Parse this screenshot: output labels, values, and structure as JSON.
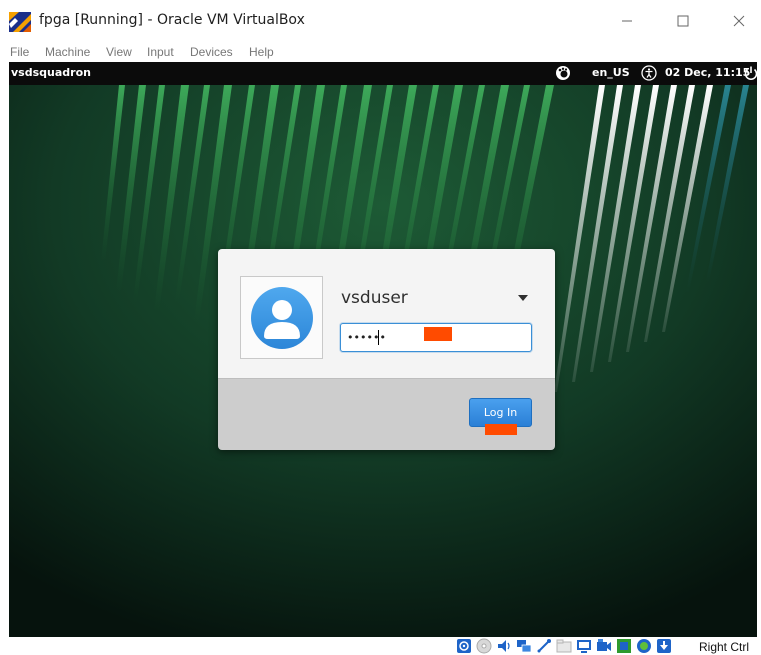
{
  "window": {
    "title": "fpga [Running] - Oracle VM VirtualBox",
    "controls": {
      "minimize": "—",
      "maximize": "☐",
      "close": "✕"
    }
  },
  "menubar": {
    "items": [
      "File",
      "Machine",
      "View",
      "Input",
      "Devices",
      "Help"
    ]
  },
  "guest": {
    "topbar": {
      "hostname": "vsdsquadron",
      "locale": "en_US",
      "datetime": "02 Dec, 11:15",
      "icons": [
        "gnome-foot-icon",
        "accessibility-icon",
        "power-icon"
      ]
    },
    "login": {
      "username": "vsduser",
      "password_value": "••••••",
      "login_button": "Log In",
      "highlight_color": "#ff4b00"
    }
  },
  "statusbar": {
    "host_key": "Right Ctrl",
    "icons": [
      "hard-disk-icon",
      "optical-disk-icon",
      "audio-icon",
      "network-icon",
      "usb-icon",
      "shared-folder-icon",
      "display-icon",
      "video-capture-icon",
      "processor-icon",
      "mouse-integration-icon",
      "keyboard-icon"
    ]
  },
  "colors": {
    "accent": "#2a7fd6",
    "wallpaper_dark": "#0b1f16",
    "stripe_green": "#2e8b45",
    "stripe_teal": "#1f6f7a"
  }
}
